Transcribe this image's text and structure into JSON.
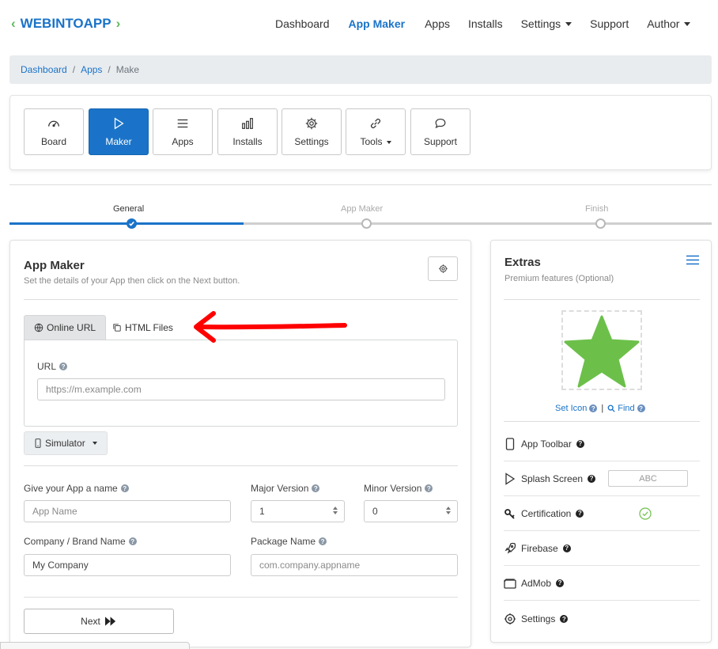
{
  "brand": {
    "part_a": "WEB",
    "part_b": "INTOAPP",
    "accent": "#1a73c8",
    "chev_color": "#5cb85c"
  },
  "topnav": {
    "items": [
      {
        "label": "Dashboard",
        "active": false,
        "dropdown": false
      },
      {
        "label": "App Maker",
        "active": true,
        "dropdown": false
      },
      {
        "label": "Apps",
        "active": false,
        "dropdown": false
      },
      {
        "label": "Installs",
        "active": false,
        "dropdown": false
      },
      {
        "label": "Settings",
        "active": false,
        "dropdown": true
      },
      {
        "label": "Support",
        "active": false,
        "dropdown": false
      },
      {
        "label": "Author",
        "active": false,
        "dropdown": true
      }
    ]
  },
  "breadcrumb": {
    "items": [
      "Dashboard",
      "Apps",
      "Make"
    ],
    "separator": "/"
  },
  "toolbar": {
    "buttons": [
      {
        "label": "Board",
        "icon": "gauge-icon"
      },
      {
        "label": "Maker",
        "icon": "play-icon",
        "active": true
      },
      {
        "label": "Apps",
        "icon": "list-icon"
      },
      {
        "label": "Installs",
        "icon": "bar-chart-icon"
      },
      {
        "label": "Settings",
        "icon": "gear-icon"
      },
      {
        "label": "Tools",
        "icon": "link-icon",
        "dropdown": true
      },
      {
        "label": "Support",
        "icon": "chat-icon"
      }
    ]
  },
  "steps": [
    {
      "label": "General",
      "state": "done"
    },
    {
      "label": "App Maker",
      "state": "pending"
    },
    {
      "label": "Finish",
      "state": "pending"
    }
  ],
  "main": {
    "title": "App Maker",
    "subtitle": "Set the details of your App then click on the Next button.",
    "tabs": [
      {
        "label": "Online URL",
        "active": true,
        "icon": "globe-icon"
      },
      {
        "label": "HTML Files",
        "active": false,
        "icon": "copy-icon"
      }
    ],
    "url": {
      "label": "URL",
      "placeholder": "https://m.example.com"
    },
    "simulator_label": "Simulator",
    "fields": {
      "app_name": {
        "label": "Give your App a name",
        "placeholder": "App Name"
      },
      "major_version": {
        "label": "Major Version",
        "value": "1"
      },
      "minor_version": {
        "label": "Minor Version",
        "value": "0"
      },
      "company": {
        "label": "Company / Brand Name",
        "value": "My Company"
      },
      "package": {
        "label": "Package Name",
        "placeholder": "com.company.appname"
      }
    },
    "next_label": "Next"
  },
  "extras": {
    "title": "Extras",
    "subtitle": "Premium features (Optional)",
    "set_icon": "Set Icon",
    "find": "Find",
    "rows": [
      {
        "label": "App Toolbar",
        "icon": "phone-icon"
      },
      {
        "label": "Splash Screen",
        "icon": "play-icon",
        "extra": "ABC"
      },
      {
        "label": "Certification",
        "icon": "key-icon"
      },
      {
        "label": "Firebase",
        "icon": "rocket-icon"
      },
      {
        "label": "AdMob",
        "icon": "wallet-icon"
      },
      {
        "label": "Settings",
        "icon": "gear-icon"
      }
    ],
    "star_color": "#6cc04a"
  },
  "annotation": {
    "arrow_color": "#ff0000"
  }
}
